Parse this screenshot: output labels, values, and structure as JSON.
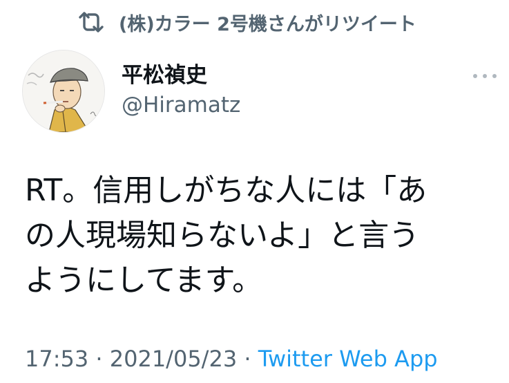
{
  "retweet": {
    "icon": "retweet-icon",
    "text": "(株)カラー 2号機さんがリツイート"
  },
  "author": {
    "avatar_icon": "avatar-illustration",
    "display_name": "平松禎史",
    "handle": "@Hiramatz"
  },
  "more": {
    "icon": "more-horizontal-icon"
  },
  "tweet": {
    "lines": [
      "RT。信用しがちな人には「あ",
      "の人現場知らないよ」と言う",
      "ようにしてます。"
    ]
  },
  "meta": {
    "time": "17:53",
    "separator": " · ",
    "date": "2021/05/23",
    "separator2": " · ",
    "source": "Twitter Web App"
  },
  "colors": {
    "text": "#0f1419",
    "secondary": "#536471",
    "link": "#1d9bf0"
  }
}
